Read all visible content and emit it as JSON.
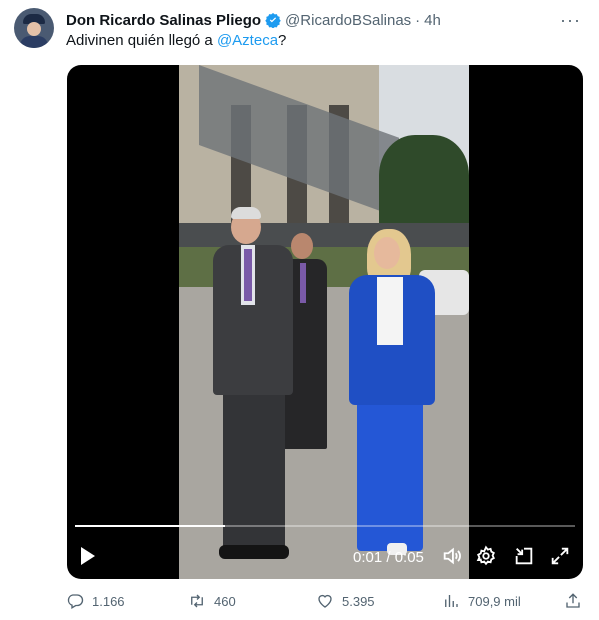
{
  "author": {
    "name": "Don Ricardo Salinas Pliego",
    "handle": "@RicardoBSalinas",
    "separator": "·",
    "time": "4h",
    "verified_icon": "verified-badge-icon",
    "more_label": "···"
  },
  "tweet": {
    "text_prefix": "Adivinen quién llegó a ",
    "mention": "@Azteca",
    "text_suffix": "?"
  },
  "video": {
    "progress": 0.3,
    "timecode": "0:01 / 0:05",
    "icons": [
      "play-icon",
      "volume-icon",
      "settings-gear-icon",
      "exit-fullscreen-icon",
      "fullscreen-icon"
    ]
  },
  "actions": {
    "replies": "1.166",
    "retweets": "460",
    "likes": "5.395",
    "views": "709,9 mil"
  },
  "colors": {
    "accent": "#1d9bf0",
    "muted": "#536471",
    "text": "#0f1419"
  }
}
